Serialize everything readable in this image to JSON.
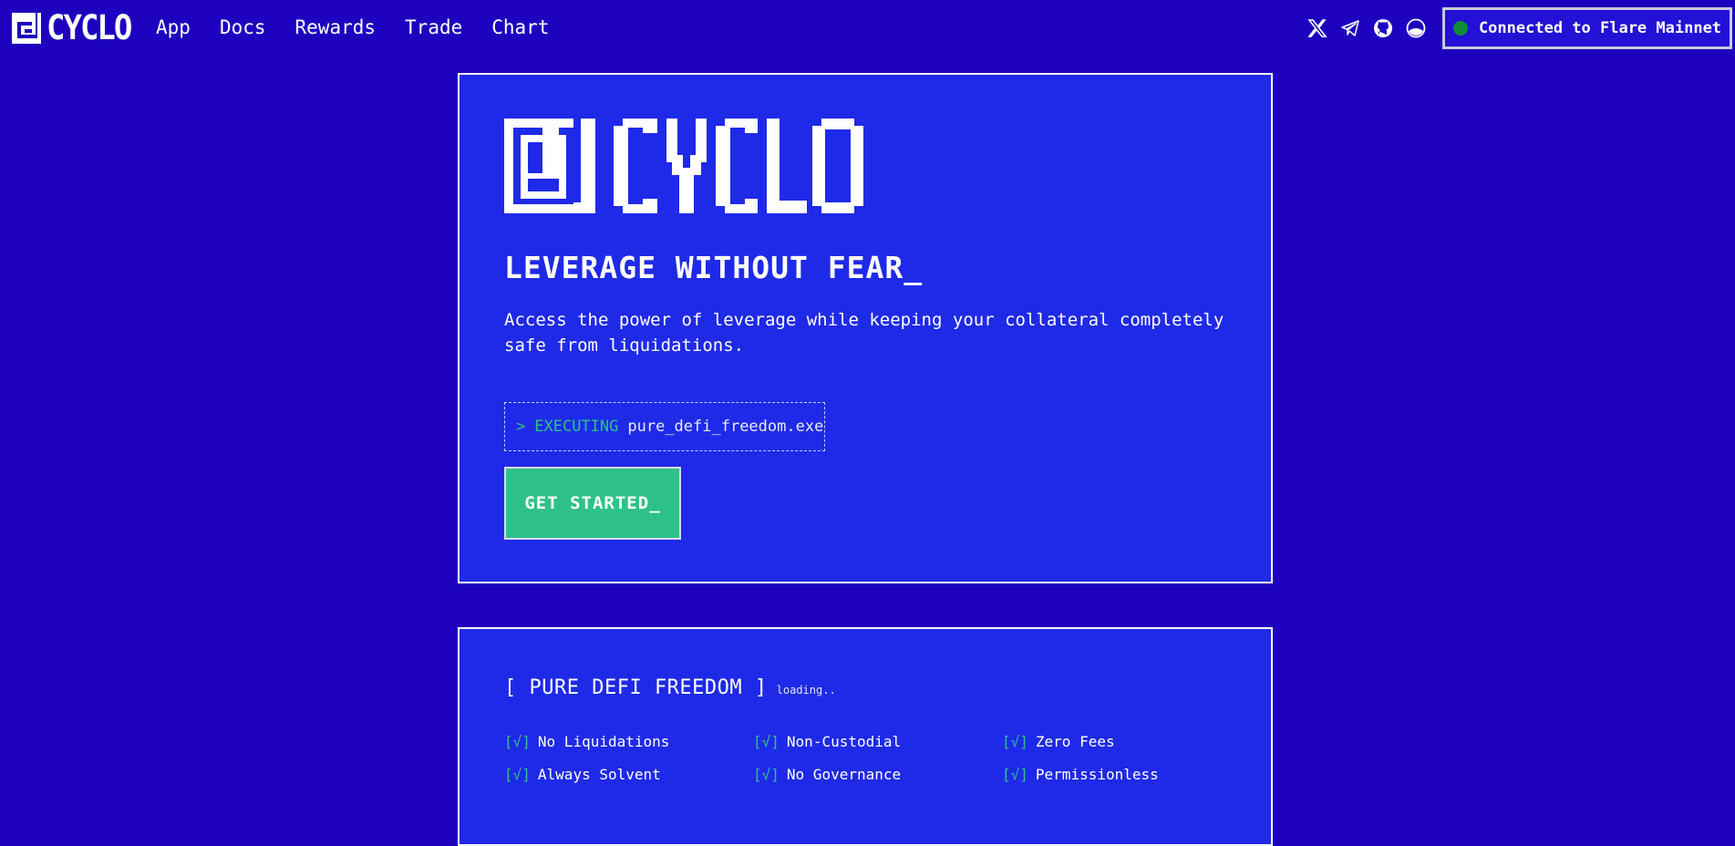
{
  "nav": {
    "logo_text": "CYCLO",
    "links": [
      "App",
      "Docs",
      "Rewards",
      "Trade",
      "Chart"
    ],
    "socials": [
      "x-icon",
      "telegram-icon",
      "github-icon",
      "half-circle-icon"
    ],
    "connect_label": "Connected to Flare Mainnet",
    "connect_status_color": "#0f8c37"
  },
  "hero": {
    "logo_text": "CYCLO",
    "headline": "LEVERAGE WITHOUT FEAR_",
    "subtext": "Access the power of leverage while keeping your collateral completely safe from liquidations.",
    "terminal": {
      "prompt": ">",
      "status": "EXECUTING",
      "file": "pure_defi_freedom.exe"
    },
    "cta_label": "GET STARTED_"
  },
  "features": {
    "title": "[ PURE DEFI FREEDOM ]",
    "loading": "loading..",
    "check_mark": "[√]",
    "items": [
      "No Liquidations",
      "Non-Custodial",
      "Zero Fees",
      "Always Solvent",
      "No Governance",
      "Permissionless"
    ]
  },
  "colors": {
    "background": "#1e00bf",
    "card": "#1f2ae8",
    "accent": "#2ec28a"
  }
}
